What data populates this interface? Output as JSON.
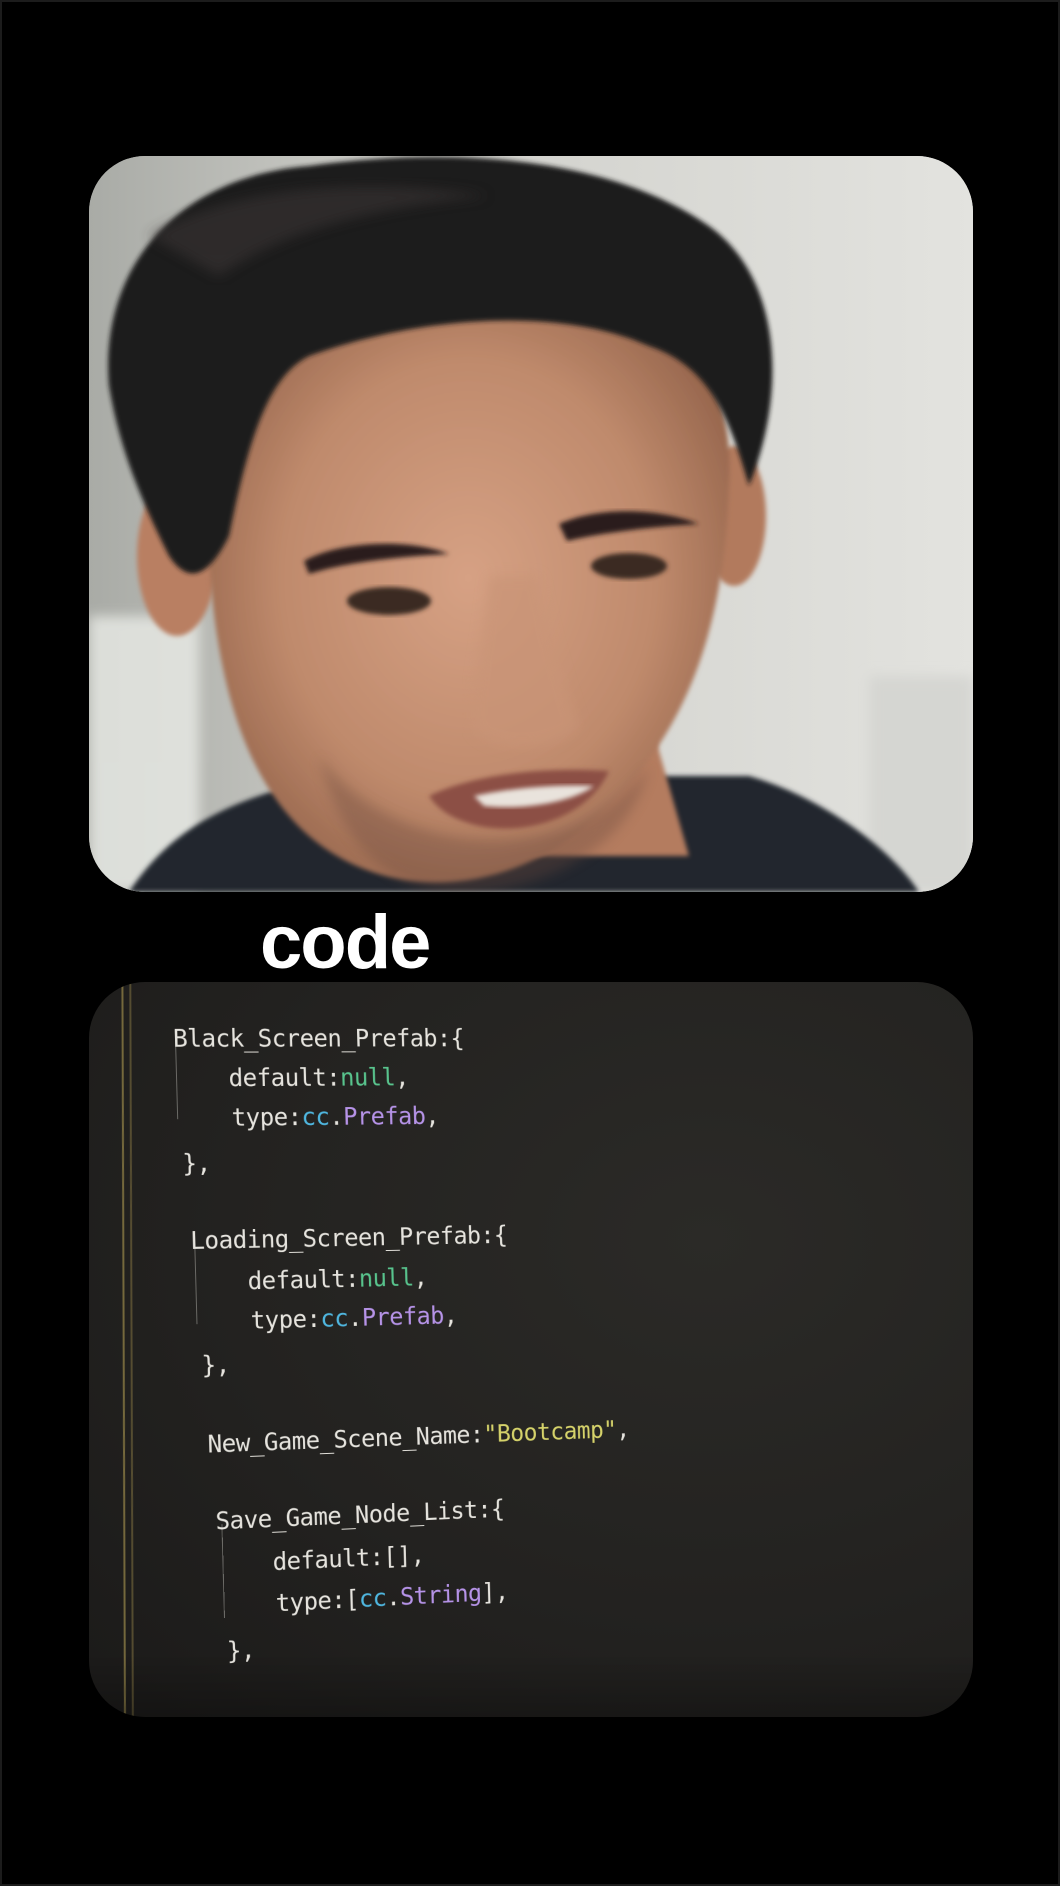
{
  "caption": {
    "text": "code"
  },
  "video": {
    "subject": "man-speaking-face-closeup"
  },
  "code": {
    "lines": [
      {
        "id": "l1",
        "parts": [
          {
            "t": "Black_Screen_Prefab:{",
            "c": "plain"
          }
        ]
      },
      {
        "id": "l2",
        "parts": [
          {
            "t": "default:",
            "c": "plain"
          },
          {
            "t": "null",
            "c": "null"
          },
          {
            "t": ",",
            "c": "plain"
          }
        ]
      },
      {
        "id": "l3",
        "parts": [
          {
            "t": "type:",
            "c": "plain"
          },
          {
            "t": "cc",
            "c": "cc"
          },
          {
            "t": ".",
            "c": "plain"
          },
          {
            "t": "Prefab",
            "c": "type"
          },
          {
            "t": ",",
            "c": "plain"
          }
        ]
      },
      {
        "id": "l4",
        "parts": [
          {
            "t": "},",
            "c": "plain"
          }
        ]
      },
      {
        "id": "l5",
        "parts": [
          {
            "t": "Loading_Screen_Prefab:{",
            "c": "plain"
          }
        ]
      },
      {
        "id": "l6",
        "parts": [
          {
            "t": "default:",
            "c": "plain"
          },
          {
            "t": "null",
            "c": "null"
          },
          {
            "t": ",",
            "c": "plain"
          }
        ]
      },
      {
        "id": "l7",
        "parts": [
          {
            "t": "type:",
            "c": "plain"
          },
          {
            "t": "cc",
            "c": "cc"
          },
          {
            "t": ".",
            "c": "plain"
          },
          {
            "t": "Prefab",
            "c": "type"
          },
          {
            "t": ",",
            "c": "plain"
          }
        ]
      },
      {
        "id": "l8",
        "parts": [
          {
            "t": "},",
            "c": "plain"
          }
        ]
      },
      {
        "id": "l9",
        "parts": [
          {
            "t": "New_Game_Scene_Name:",
            "c": "plain"
          },
          {
            "t": "\"Bootcamp\"",
            "c": "str"
          },
          {
            "t": ",",
            "c": "plain"
          }
        ]
      },
      {
        "id": "l10",
        "parts": [
          {
            "t": "Save_Game_Node_List:{",
            "c": "plain"
          }
        ]
      },
      {
        "id": "l11",
        "parts": [
          {
            "t": "default:[],",
            "c": "plain"
          }
        ]
      },
      {
        "id": "l12",
        "parts": [
          {
            "t": "type:[",
            "c": "plain"
          },
          {
            "t": "cc",
            "c": "cc"
          },
          {
            "t": ".",
            "c": "plain"
          },
          {
            "t": "String",
            "c": "type"
          },
          {
            "t": "],",
            "c": "plain"
          }
        ]
      },
      {
        "id": "l13",
        "parts": [
          {
            "t": "},",
            "c": "plain"
          }
        ]
      }
    ]
  },
  "colors": {
    "page_background": "#000000",
    "code_background": "#232220",
    "code_text": "#e6e4de",
    "null_keyword": "#58c48d",
    "cc_namespace": "#4fb7e0",
    "type_name": "#b693e8",
    "string_literal": "#d6d36a",
    "caption_text": "#ffffff"
  }
}
